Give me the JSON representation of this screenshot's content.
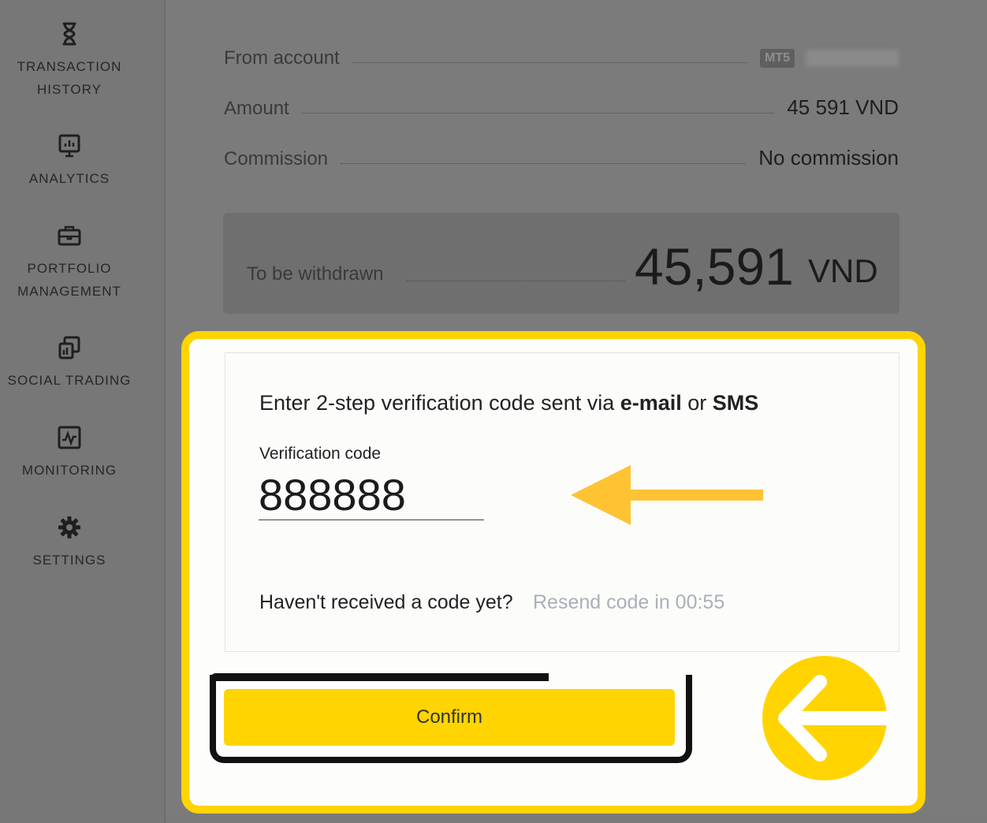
{
  "sidebar": {
    "items": [
      {
        "label": "TRANSACTION\nHISTORY",
        "icon": "hourglass-icon"
      },
      {
        "label": "ANALYTICS",
        "icon": "analytics-icon"
      },
      {
        "label": "PORTFOLIO\nMANAGEMENT",
        "icon": "briefcase-icon"
      },
      {
        "label": "SOCIAL TRADING",
        "icon": "copy-icon"
      },
      {
        "label": "MONITORING",
        "icon": "monitoring-icon"
      },
      {
        "label": "SETTINGS",
        "icon": "gear-icon"
      }
    ]
  },
  "summary": {
    "from_account_label": "From account",
    "account_badge": "MT5",
    "amount_label": "Amount",
    "amount_value": "45 591 VND",
    "commission_label": "Commission",
    "commission_value": "No commission",
    "withdrawn_label": "To be withdrawn",
    "withdrawn_amount": "45,591",
    "withdrawn_currency": "VND"
  },
  "verification": {
    "instruction_prefix": "Enter 2-step verification code sent via ",
    "instruction_email": "e-mail",
    "instruction_or": " or ",
    "instruction_sms": "SMS",
    "code_label": "Verification code",
    "code_value": "888888",
    "resend_question": "Haven't received a code yet?",
    "resend_link": "Resend code in 00:55"
  },
  "actions": {
    "confirm_label": "Confirm"
  },
  "colors": {
    "accent": "#ffd400",
    "arrow": "#ffc233",
    "overlay": "#7a7a7a"
  }
}
